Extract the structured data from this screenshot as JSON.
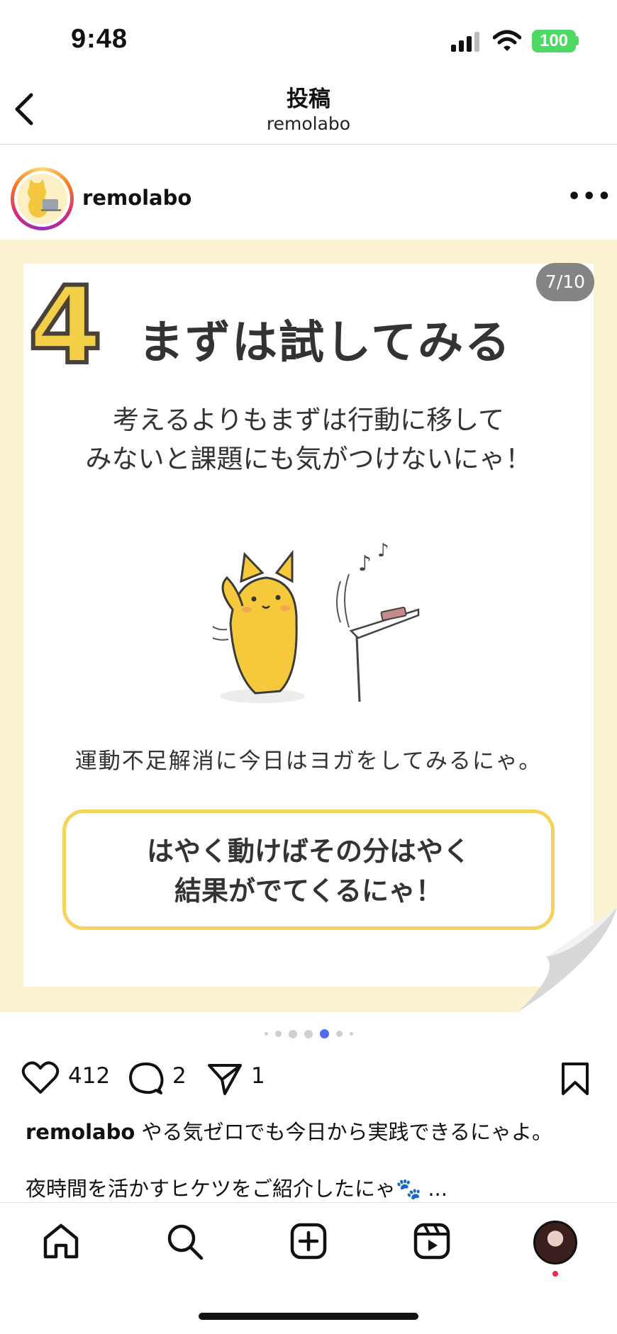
{
  "status": {
    "time": "9:48",
    "battery": "100"
  },
  "nav": {
    "title": "投稿",
    "subtitle": "remolabo"
  },
  "post": {
    "username": "remolabo",
    "slide_counter": "7/10",
    "slide": {
      "step_number": "4",
      "title": "まずは試してみる",
      "lead_line1": "考えるよりもまずは行動に移して",
      "lead_line2": "みないと課題にも気がつけないにゃ！",
      "caption": "運動不足解消に今日はヨガをしてみるにゃ。",
      "callout_line1": "はやく動けばその分はやく",
      "callout_line2": "結果がでてくるにゃ！"
    },
    "likes": "412",
    "comments": "2",
    "shares": "1",
    "caption_user": "remolabo",
    "caption_text": " やる気ゼロでも今日から実践できるにゃよ。",
    "caption_line2": "夜時間を活かすヒケツをご紹介したにゃ🐾 ..."
  },
  "colors": {
    "accent_blue": "#4f6cf0",
    "callout_border": "#f4d35c",
    "frame_bg": "#fbf2d0"
  }
}
